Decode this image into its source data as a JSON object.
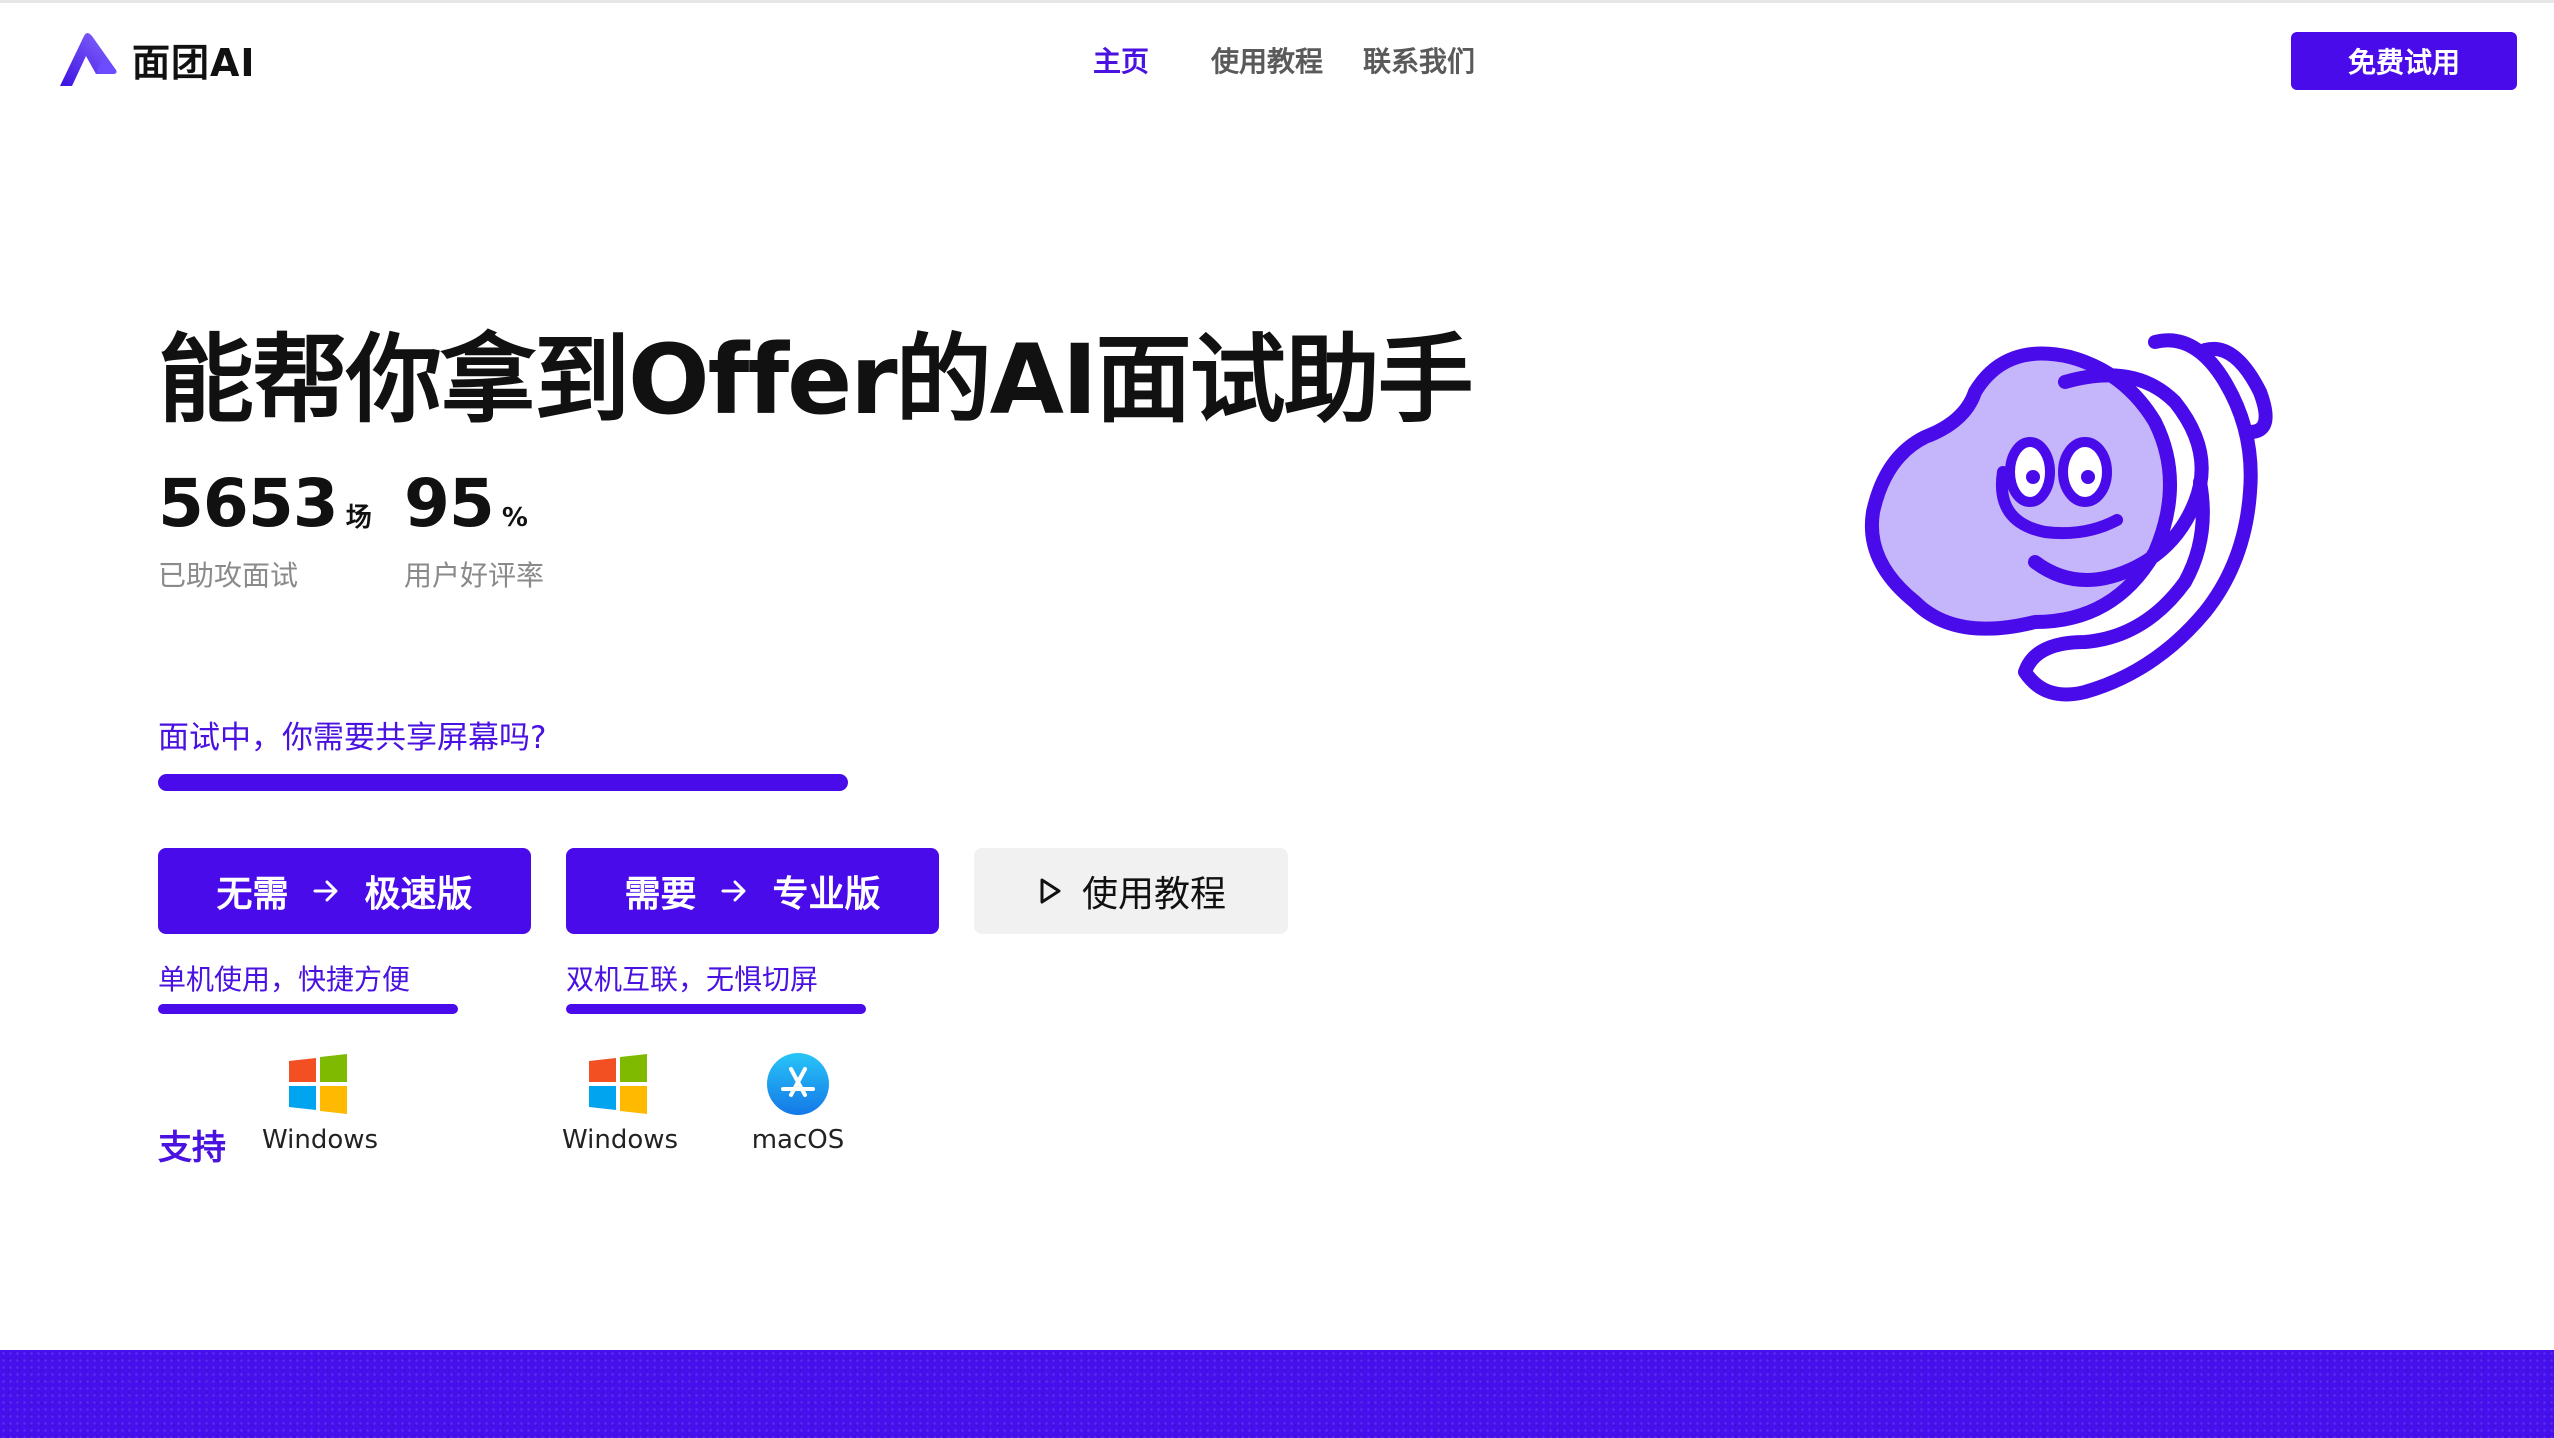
{
  "brand": {
    "name": "面团AI",
    "accent": "#4a0bea"
  },
  "nav": {
    "items": [
      "主页",
      "使用教程",
      "联系我们"
    ],
    "active": "主页"
  },
  "header": {
    "trial_button": "免费试用"
  },
  "hero": {
    "title": "能帮你拿到Offer的AI面试助手",
    "stats": [
      {
        "value": "5653",
        "unit": "场",
        "label": "已助攻面试"
      },
      {
        "value": "95",
        "unit": "%",
        "label": "用户好评率"
      }
    ],
    "question": "面试中，你需要共享屏幕吗?"
  },
  "options": [
    {
      "prefix": "无需",
      "name": "极速版",
      "desc": "单机使用，快捷方便"
    },
    {
      "prefix": "需要",
      "name": "专业版",
      "desc": "双机互联，无惧切屏"
    }
  ],
  "tutorial_button": "使用教程",
  "support": {
    "label": "支持",
    "platforms": [
      {
        "name": "Windows",
        "icon": "windows-icon"
      },
      {
        "name": "Windows",
        "icon": "windows-icon"
      },
      {
        "name": "macOS",
        "icon": "app-store-icon"
      }
    ]
  }
}
